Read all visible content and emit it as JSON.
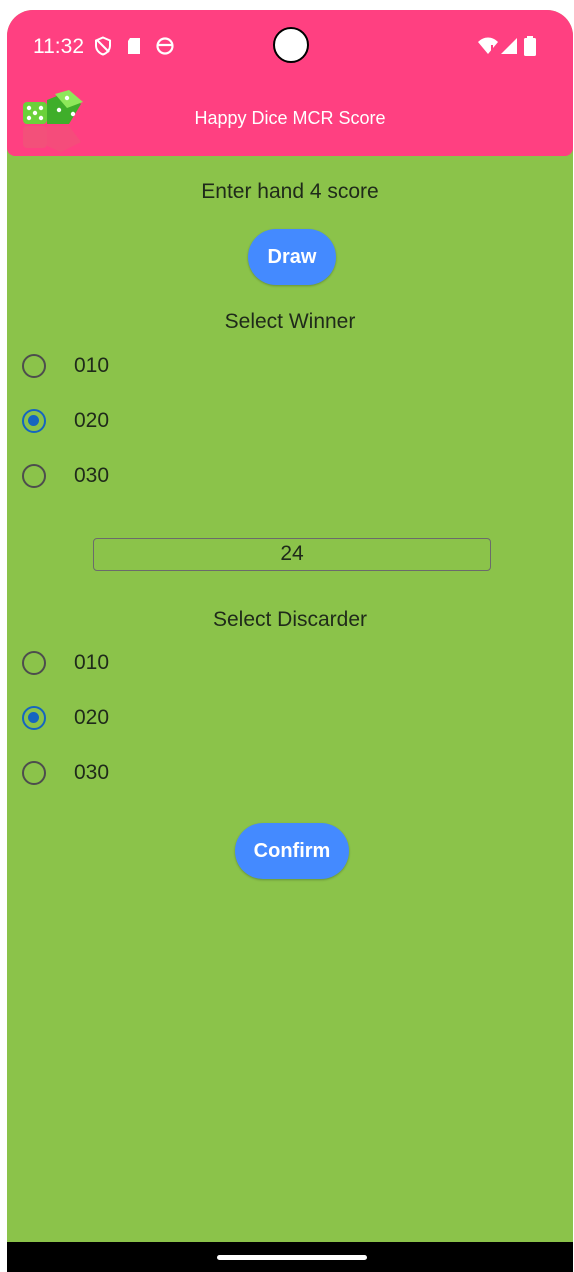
{
  "status_bar": {
    "time": "11:32",
    "icons": [
      "shield-icon",
      "sd-card-icon",
      "smiley-icon",
      "wifi-icon",
      "signal-icon",
      "battery-icon"
    ]
  },
  "app_bar": {
    "title": "Happy Dice MCR Score",
    "logo": "dice-logo-icon"
  },
  "main": {
    "hand_heading": "Enter hand 4 score",
    "draw_label": "Draw",
    "winner_heading": "Select Winner",
    "winner_options": [
      {
        "label": "010",
        "selected": false
      },
      {
        "label": "020",
        "selected": true
      },
      {
        "label": "030",
        "selected": false
      }
    ],
    "score_value": "24",
    "discarder_heading": "Select Discarder",
    "discarder_options": [
      {
        "label": "010",
        "selected": false
      },
      {
        "label": "020",
        "selected": true
      },
      {
        "label": "030",
        "selected": false
      }
    ],
    "confirm_label": "Confirm"
  },
  "colors": {
    "header": "#FF4081",
    "background": "#8BC34A",
    "button": "#448AFF",
    "radio_selected": "#1565C0"
  }
}
